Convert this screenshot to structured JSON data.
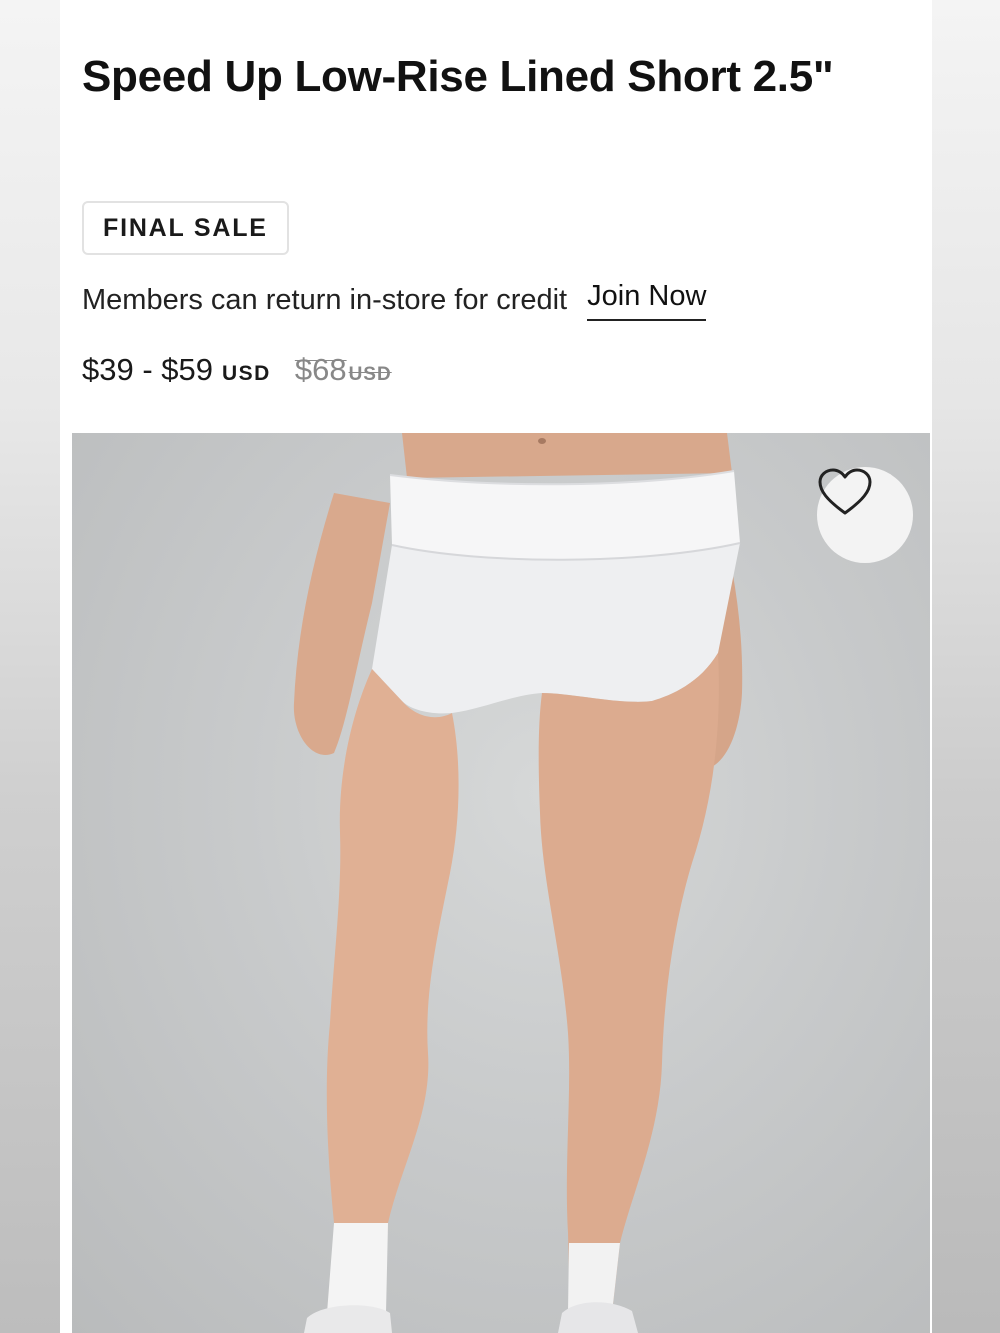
{
  "product": {
    "title": "Speed Up Low-Rise Lined Short 2.5\"",
    "badge": "FINAL SALE",
    "members_note": "Members can return in-store for credit",
    "join_link": "Join Now",
    "price": {
      "range": "$39 - $59",
      "currency": "USD",
      "original": "$68",
      "original_currency": "USD"
    },
    "image_alt": "Model wearing white low-rise lined running shorts with white socks and sneakers",
    "favorite_icon": "heart-outline-icon"
  }
}
